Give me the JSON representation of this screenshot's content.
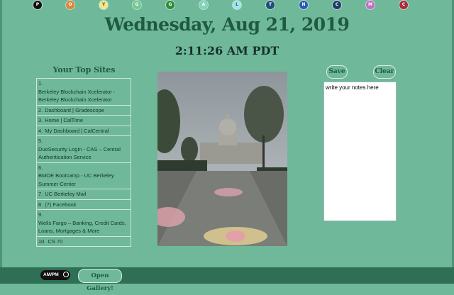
{
  "theme_dots": [
    {
      "label": "P",
      "color": "#111111"
    },
    {
      "label": "O",
      "color": "#e0843a"
    },
    {
      "label": "Y",
      "color": "#f0e88a"
    },
    {
      "label": "G",
      "color": "#74c98f"
    },
    {
      "label": "G",
      "color": "#2e8b3a"
    },
    {
      "label": "A",
      "color": "#7fd4b8"
    },
    {
      "label": "L",
      "color": "#9ee6f0"
    },
    {
      "label": "T",
      "color": "#1f4e7a"
    },
    {
      "label": "N",
      "color": "#2a5bb8"
    },
    {
      "label": "C",
      "color": "#223a6a"
    },
    {
      "label": "M",
      "color": "#c86ac8"
    },
    {
      "label": "C",
      "color": "#b02a3a"
    }
  ],
  "clock": {
    "date": "Wednesday, Aug 21, 2019",
    "time": "2:11:26 AM PDT"
  },
  "top_sites": {
    "title": "Your Top Sites",
    "items": [
      {
        "num": "1.",
        "label": "Berkeley Blockchain Xcelerator - Berkeley Blockchain Xcelerator",
        "inline": false
      },
      {
        "num": "2.",
        "label": "Dashboard | Gradescope",
        "inline": true
      },
      {
        "num": "3.",
        "label": "Home | CalTime",
        "inline": true
      },
      {
        "num": "4.",
        "label": "My Dashboard | CalCentral",
        "inline": true
      },
      {
        "num": "5.",
        "label": "DuoSecurity Login - CAS – Central Authentication Service",
        "inline": false
      },
      {
        "num": "6.",
        "label": "BMOE Bootcamp - UC Berkeley Summer Center",
        "inline": false
      },
      {
        "num": "7.",
        "label": "UC Berkeley Mail",
        "inline": true
      },
      {
        "num": "8.",
        "label": "(7) Facebook",
        "inline": true
      },
      {
        "num": "9.",
        "label": "Wells Fargo – Banking, Credit Cards, Loans, Mortgages & More",
        "inline": false
      },
      {
        "num": "10.",
        "label": "CS 70",
        "inline": true
      }
    ]
  },
  "notes": {
    "save_label": "Save",
    "clear_label": "Clear",
    "text": "write your notes here"
  },
  "footer": {
    "toggle_label": "AM/PM",
    "gallery_label": "Open Gallery!"
  }
}
